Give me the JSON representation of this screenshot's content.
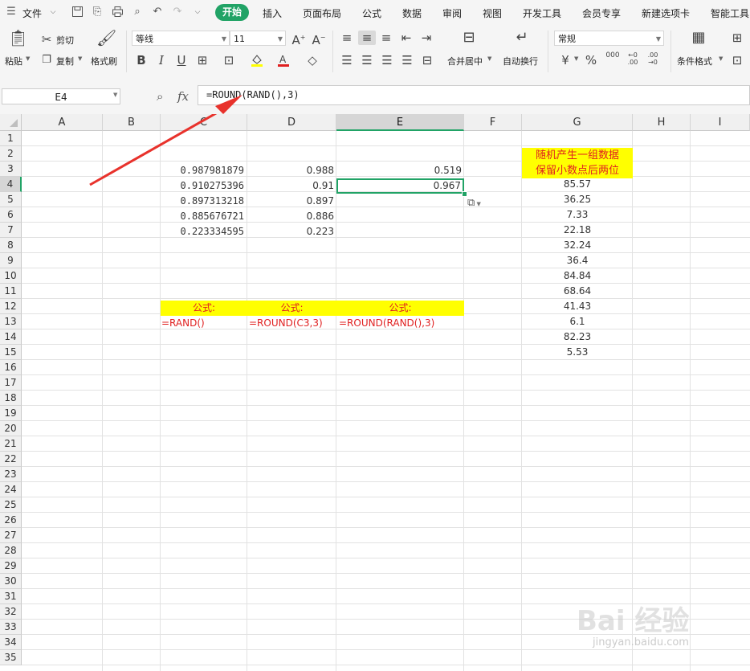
{
  "menu": {
    "file_label": "文件",
    "tabs": [
      "开始",
      "插入",
      "页面布局",
      "公式",
      "数据",
      "审阅",
      "视图",
      "开发工具",
      "会员专享",
      "新建选项卡",
      "智能工具"
    ]
  },
  "toolbar": {
    "paste": "粘贴",
    "cut": "剪切",
    "copy": "复制",
    "format_painter": "格式刷",
    "font_name": "等线",
    "font_size": "11",
    "merge_center": "合并居中",
    "wrap_text": "自动换行",
    "number_format": "常规",
    "conditional_format": "条件格式",
    "percent_symbol": "%",
    "currency_symbol": "¥"
  },
  "formula_bar": {
    "name_box": "E4",
    "fx_label": "fx",
    "formula": "=ROUND(RAND(),3)"
  },
  "sheet": {
    "columns": [
      "A",
      "B",
      "C",
      "D",
      "E",
      "F",
      "G",
      "H",
      "I"
    ],
    "selected_cell": "E4",
    "rows": [
      "1",
      "2",
      "3",
      "4",
      "5",
      "6",
      "7",
      "8",
      "9",
      "10",
      "11",
      "12",
      "13",
      "14",
      "15",
      "16",
      "17",
      "18",
      "19",
      "20",
      "21",
      "22",
      "23",
      "24",
      "25",
      "26",
      "27",
      "28",
      "29",
      "30",
      "31",
      "32",
      "33",
      "34",
      "35"
    ],
    "c_values": [
      "0.987981879",
      "0.910275396",
      "0.897313218",
      "0.885676721",
      "0.223334595"
    ],
    "d_values": [
      "0.988",
      "0.91",
      "0.897",
      "0.886",
      "0.223"
    ],
    "e_values": [
      "0.519",
      "0.967"
    ],
    "formula_headers": [
      "公式:",
      "公式:",
      "公式:"
    ],
    "formula_examples": [
      "=RAND()",
      "=ROUND(C3,3)",
      "=ROUND(RAND(),3)"
    ],
    "g_header_line1": "随机产生一组数据",
    "g_header_line2": "保留小数点后两位",
    "g_values": [
      "85.57",
      "36.25",
      "7.33",
      "22.18",
      "32.24",
      "36.4",
      "84.84",
      "68.64",
      "41.43",
      "6.1",
      "82.23",
      "5.53"
    ]
  },
  "watermark": {
    "brand": "Bai 经验",
    "url": "jingyan.baidu.com"
  },
  "colors": {
    "accent_green": "#21a366",
    "highlight_yellow": "#ffff00",
    "red_text": "#e02020",
    "annotation_arrow": "#e8322c"
  }
}
